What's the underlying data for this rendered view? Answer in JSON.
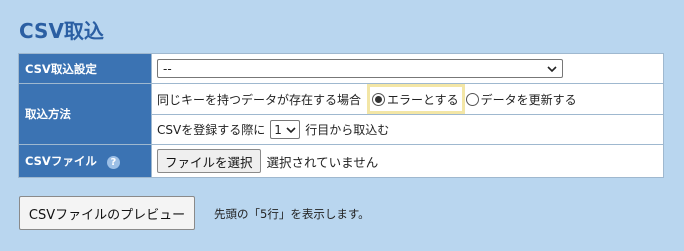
{
  "page": {
    "title": "CSV取込"
  },
  "form": {
    "csv_settings": {
      "label": "CSV取込設定",
      "selected_value": "--"
    },
    "import_method": {
      "label": "取込方法",
      "duplicate_text": "同じキーを持つデータが存在する場合",
      "options": [
        {
          "label": "エラーとする",
          "checked": true
        },
        {
          "label": "データを更新する",
          "checked": false
        }
      ],
      "start_prefix": "CSVを登録する際に",
      "start_row_value": "1",
      "start_suffix": "行目から取込む"
    },
    "csv_file": {
      "label": "CSVファイル",
      "help_glyph": "?",
      "choose_button": "ファイルを選択",
      "status": "選択されていません"
    }
  },
  "preview": {
    "button_label": "CSVファイルのプレビュー",
    "note": "先頭の「5行」を表示します。"
  }
}
